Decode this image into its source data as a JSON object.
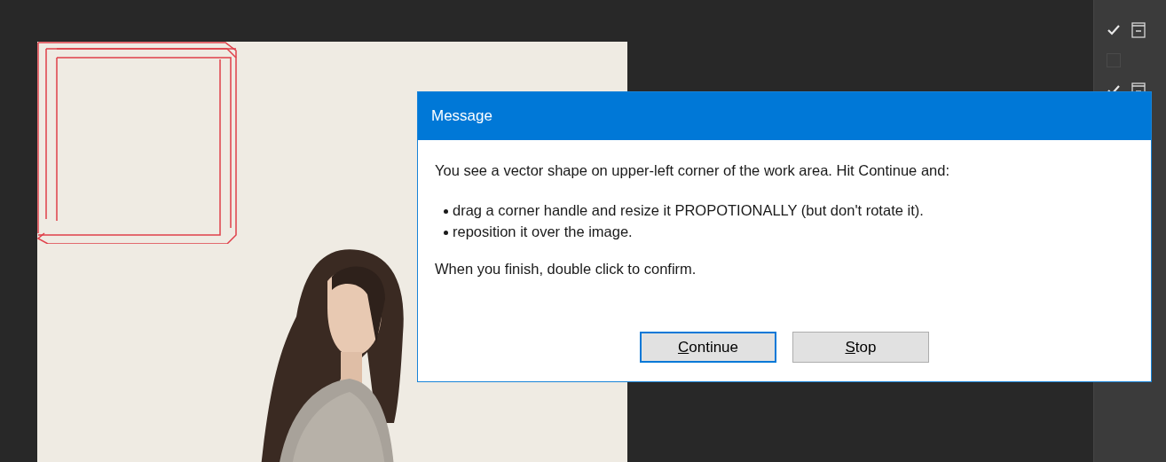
{
  "layers": [
    {
      "visible": true
    },
    {
      "visible": false
    },
    {
      "visible": true
    }
  ],
  "dialog": {
    "title": "Message",
    "intro": "You see a vector shape on upper-left corner of the work area. Hit Continue and:",
    "bullets": [
      "drag a corner handle and resize it PROPOTIONALLY (but don't rotate it).",
      "reposition it over the image."
    ],
    "closing": "When you finish, double click to confirm.",
    "buttons": [
      {
        "label": "Continue",
        "focused": true,
        "access_key": true
      },
      {
        "label": "Stop",
        "focused": false,
        "access_key": true
      }
    ]
  }
}
